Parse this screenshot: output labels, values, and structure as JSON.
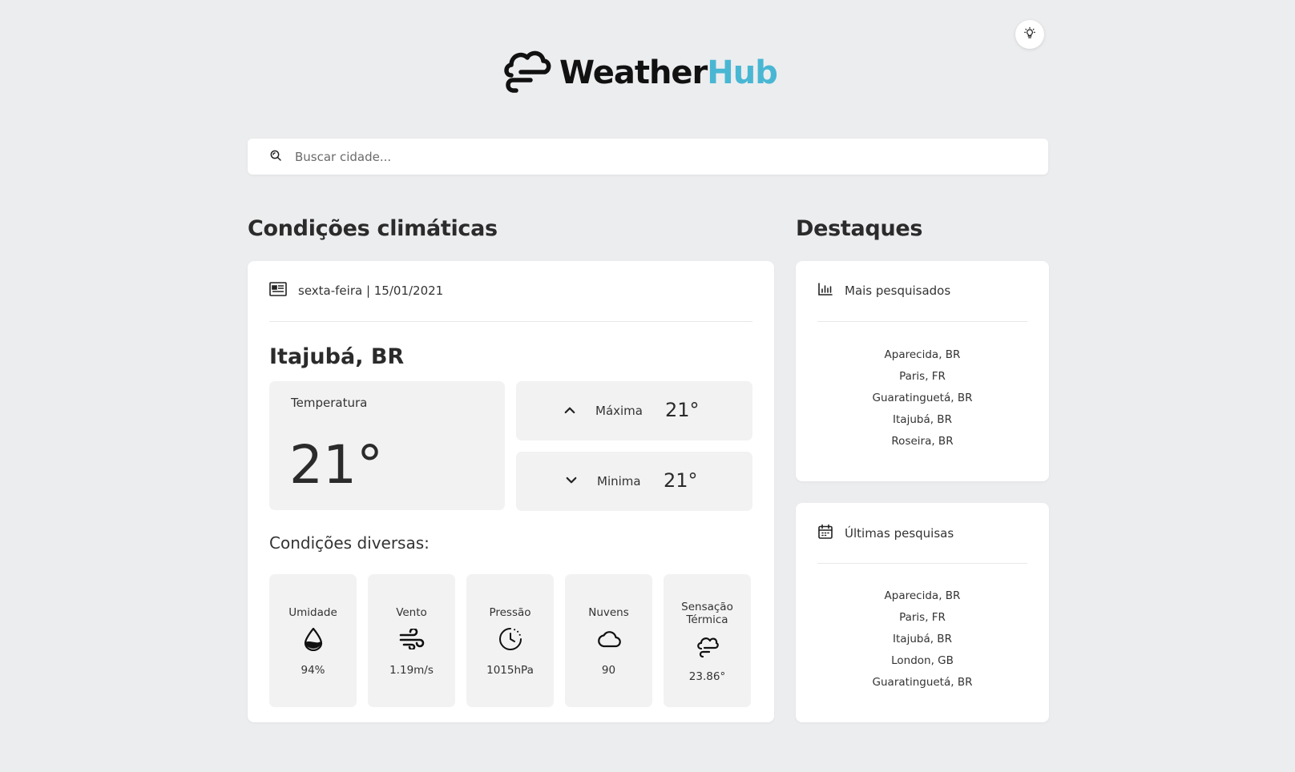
{
  "app": {
    "brand_part1": "Weather",
    "brand_part2": "Hub",
    "brand_colors": {
      "dark": "#111111",
      "accent": "#49b7d3"
    },
    "theme_toggle_icon": "lightbulb-icon"
  },
  "search": {
    "placeholder": "Buscar cidade...",
    "value": "",
    "icon": "search-icon"
  },
  "main": {
    "section_title": "Condições climáticas",
    "date_icon": "newspaper-icon",
    "date_text": "sexta-feira | 15/01/2021",
    "city": "Itajubá, BR",
    "temperature": {
      "label": "Temperatura",
      "value": "21°"
    },
    "max": {
      "label": "Máxima",
      "value": "21°",
      "icon": "chevron-up-icon"
    },
    "min": {
      "label": "Minima",
      "value": "21°",
      "icon": "chevron-down-icon"
    },
    "conditions_title": "Condições diversas:",
    "conditions": [
      {
        "label": "Umidade",
        "icon": "droplet-icon",
        "value": "94%"
      },
      {
        "label": "Vento",
        "icon": "wind-icon",
        "value": "1.19m/s"
      },
      {
        "label": "Pressão",
        "icon": "gauge-icon",
        "value": "1015hPa"
      },
      {
        "label": "Nuvens",
        "icon": "cloud-icon",
        "value": "90"
      },
      {
        "label": "Sensação Térmica",
        "icon": "cloud-sun-icon",
        "value": "23.86°"
      }
    ]
  },
  "highlights": {
    "section_title": "Destaques",
    "most_searched": {
      "title": "Mais pesquisados",
      "icon": "bar-chart-icon",
      "items": [
        "Aparecida, BR",
        "Paris, FR",
        "Guaratinguetá, BR",
        "Itajubá, BR",
        "Roseira, BR"
      ]
    },
    "recent": {
      "title": "Últimas pesquisas",
      "icon": "calendar-icon",
      "items": [
        "Aparecida, BR",
        "Paris, FR",
        "Itajubá, BR",
        "London, GB",
        "Guaratinguetá, BR"
      ]
    }
  }
}
